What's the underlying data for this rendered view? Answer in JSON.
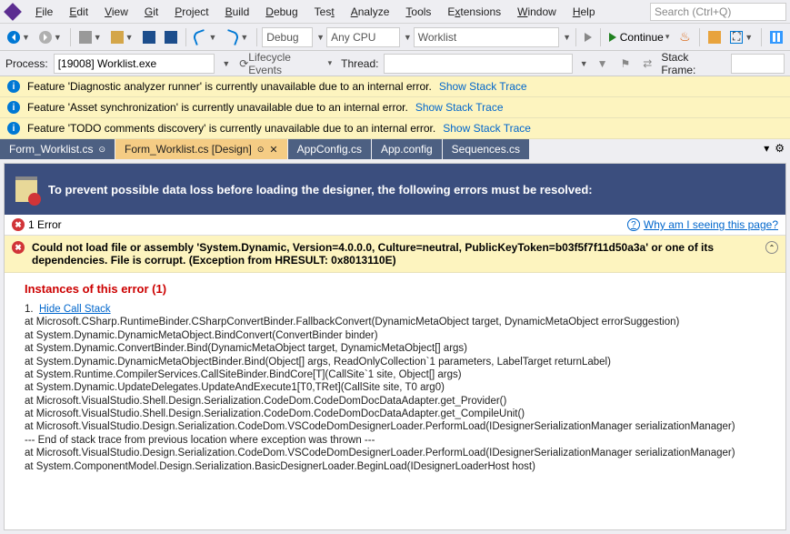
{
  "menu": {
    "items": [
      {
        "u": "F",
        "rest": "ile"
      },
      {
        "u": "E",
        "rest": "dit"
      },
      {
        "u": "V",
        "rest": "iew"
      },
      {
        "u": "G",
        "rest": "it"
      },
      {
        "u": "P",
        "rest": "roject"
      },
      {
        "u": "B",
        "rest": "uild"
      },
      {
        "u": "D",
        "rest": "ebug"
      },
      {
        "u": "",
        "rest": "Tes",
        "u2": "t"
      },
      {
        "u": "A",
        "rest": "nalyze"
      },
      {
        "u": "T",
        "rest": "ools"
      },
      {
        "u": "",
        "rest": "E",
        "u2": "x",
        "rest2": "tensions"
      },
      {
        "u": "W",
        "rest": "indow"
      },
      {
        "u": "H",
        "rest": "elp"
      }
    ],
    "search_placeholder": "Search (Ctrl+Q)"
  },
  "toolbar1": {
    "config": "Debug",
    "platform": "Any CPU",
    "startup": "Worklist",
    "continue": "Continue"
  },
  "toolbar2": {
    "process_label": "Process:",
    "process": "[19008] Worklist.exe",
    "lifecycle": "Lifecycle Events",
    "thread_label": "Thread:",
    "stack_label": "Stack Frame:"
  },
  "infobars": [
    {
      "text": "Feature 'Diagnostic analyzer runner' is currently unavailable due to an internal error.",
      "link": "Show Stack Trace"
    },
    {
      "text": "Feature 'Asset synchronization' is currently unavailable due to an internal error.",
      "link": "Show Stack Trace"
    },
    {
      "text": "Feature 'TODO comments discovery' is currently unavailable due to an internal error.",
      "link": "Show Stack Trace"
    }
  ],
  "tabs": [
    {
      "label": "Form_Worklist.cs",
      "kind": "blue",
      "pinned": true
    },
    {
      "label": "Form_Worklist.cs [Design]",
      "kind": "active",
      "pinned": true,
      "close": true
    },
    {
      "label": "AppConfig.cs",
      "kind": "blue"
    },
    {
      "label": "App.config",
      "kind": "blue"
    },
    {
      "label": "Sequences.cs",
      "kind": "blue"
    }
  ],
  "designer": {
    "banner": "To prevent possible data loss before loading the designer, the following errors must be resolved:",
    "error_count": "1 Error",
    "why": "Why am I seeing this page?",
    "error_msg": "Could not load file or assembly 'System.Dynamic, Version=4.0.0.0, Culture=neutral, PublicKeyToken=b03f5f7f11d50a3a' or one of its dependencies. File is corrupt. (Exception from HRESULT: 0x8013110E)",
    "instances_heading": "Instances of this error (1)",
    "hide_link": "Hide Call Stack",
    "stack": [
      "at Microsoft.CSharp.RuntimeBinder.CSharpConvertBinder.FallbackConvert(DynamicMetaObject target, DynamicMetaObject errorSuggestion)",
      "at System.Dynamic.DynamicMetaObject.BindConvert(ConvertBinder binder)",
      "at System.Dynamic.ConvertBinder.Bind(DynamicMetaObject target, DynamicMetaObject[] args)",
      "at System.Dynamic.DynamicMetaObjectBinder.Bind(Object[] args, ReadOnlyCollection`1 parameters, LabelTarget returnLabel)",
      "at System.Runtime.CompilerServices.CallSiteBinder.BindCore[T](CallSite`1 site, Object[] args)",
      "at System.Dynamic.UpdateDelegates.UpdateAndExecute1[T0,TRet](CallSite site, T0 arg0)",
      "at Microsoft.VisualStudio.Shell.Design.Serialization.CodeDom.CodeDomDocDataAdapter.get_Provider()",
      "at Microsoft.VisualStudio.Shell.Design.Serialization.CodeDom.CodeDomDocDataAdapter.get_CompileUnit()",
      "at Microsoft.VisualStudio.Design.Serialization.CodeDom.VSCodeDomDesignerLoader.PerformLoad(IDesignerSerializationManager serializationManager)",
      "--- End of stack trace from previous location where exception was thrown ---",
      "at Microsoft.VisualStudio.Design.Serialization.CodeDom.VSCodeDomDesignerLoader.PerformLoad(IDesignerSerializationManager serializationManager)",
      "at System.ComponentModel.Design.Serialization.BasicDesignerLoader.BeginLoad(IDesignerLoaderHost host)"
    ]
  }
}
